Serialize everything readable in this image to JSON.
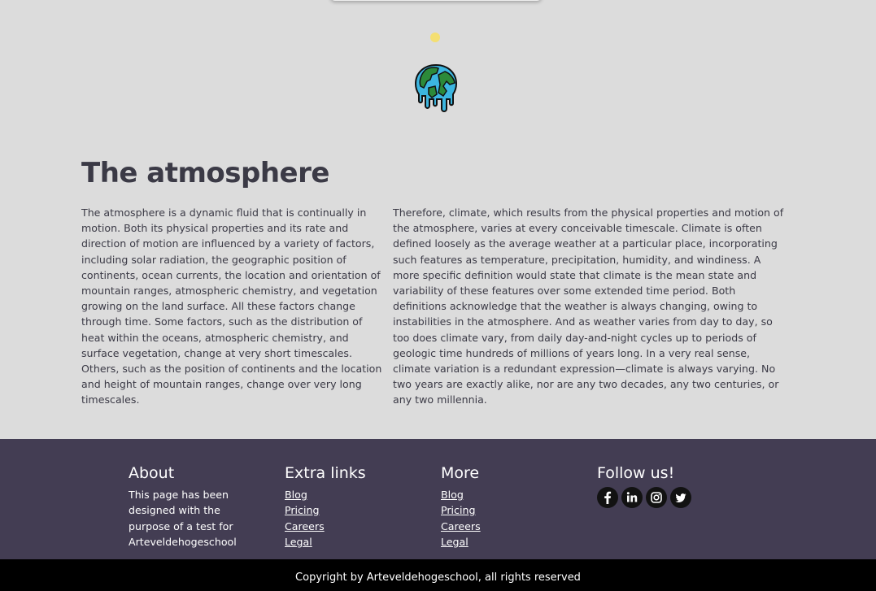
{
  "header": {
    "icon": "melting-earth-icon",
    "dot_color": "#f4df72"
  },
  "main": {
    "title": "The atmosphere",
    "paragraph_left": "The atmosphere is a dynamic fluid that is continually in motion. Both its physical properties and its rate and direction of motion are influenced by a variety of factors, including solar radiation, the geographic position of continents, ocean currents, the location and orientation of mountain ranges, atmospheric chemistry, and vegetation growing on the land surface. All these factors change through time. Some factors, such as the distribution of heat within the oceans, atmospheric chemistry, and surface vegetation, change at very short timescales. Others, such as the position of continents and the location and height of mountain ranges, change over very long timescales.",
    "paragraph_right": "Therefore, climate, which results from the physical properties and motion of the atmosphere, varies at every conceivable timescale. Climate is often defined loosely as the average weather at a particular place, incorporating such features as temperature, precipitation, humidity, and windiness. A more specific definition would state that climate is the mean state and variability of these features over some extended time period. Both definitions acknowledge that the weather is always changing, owing to instabilities in the atmosphere. And as weather varies from day to day, so too does climate vary, from daily day-and-night cycles up to periods of geologic time hundreds of millions of years long. In a very real sense, climate variation is a redundant expression—climate is always varying. No two years are exactly alike, nor are any two decades, any two centuries, or any two millennia."
  },
  "footer": {
    "background": "#433d53",
    "about": {
      "title": "About",
      "text": "This page has been designed with the purpose of a test for Arteveldehogeschool"
    },
    "extra_links": {
      "title": "Extra links",
      "links": [
        "Blog",
        "Pricing",
        "Careers",
        "Legal"
      ]
    },
    "more": {
      "title": "More",
      "links": [
        "Blog",
        "Pricing",
        "Careers",
        "Legal"
      ]
    },
    "follow": {
      "title": "Follow us!",
      "icons": [
        "facebook-icon",
        "linkedin-icon",
        "instagram-icon",
        "twitter-icon"
      ]
    },
    "copyright": "Copyright by Arteveldehogeschool, all rights reserved"
  }
}
